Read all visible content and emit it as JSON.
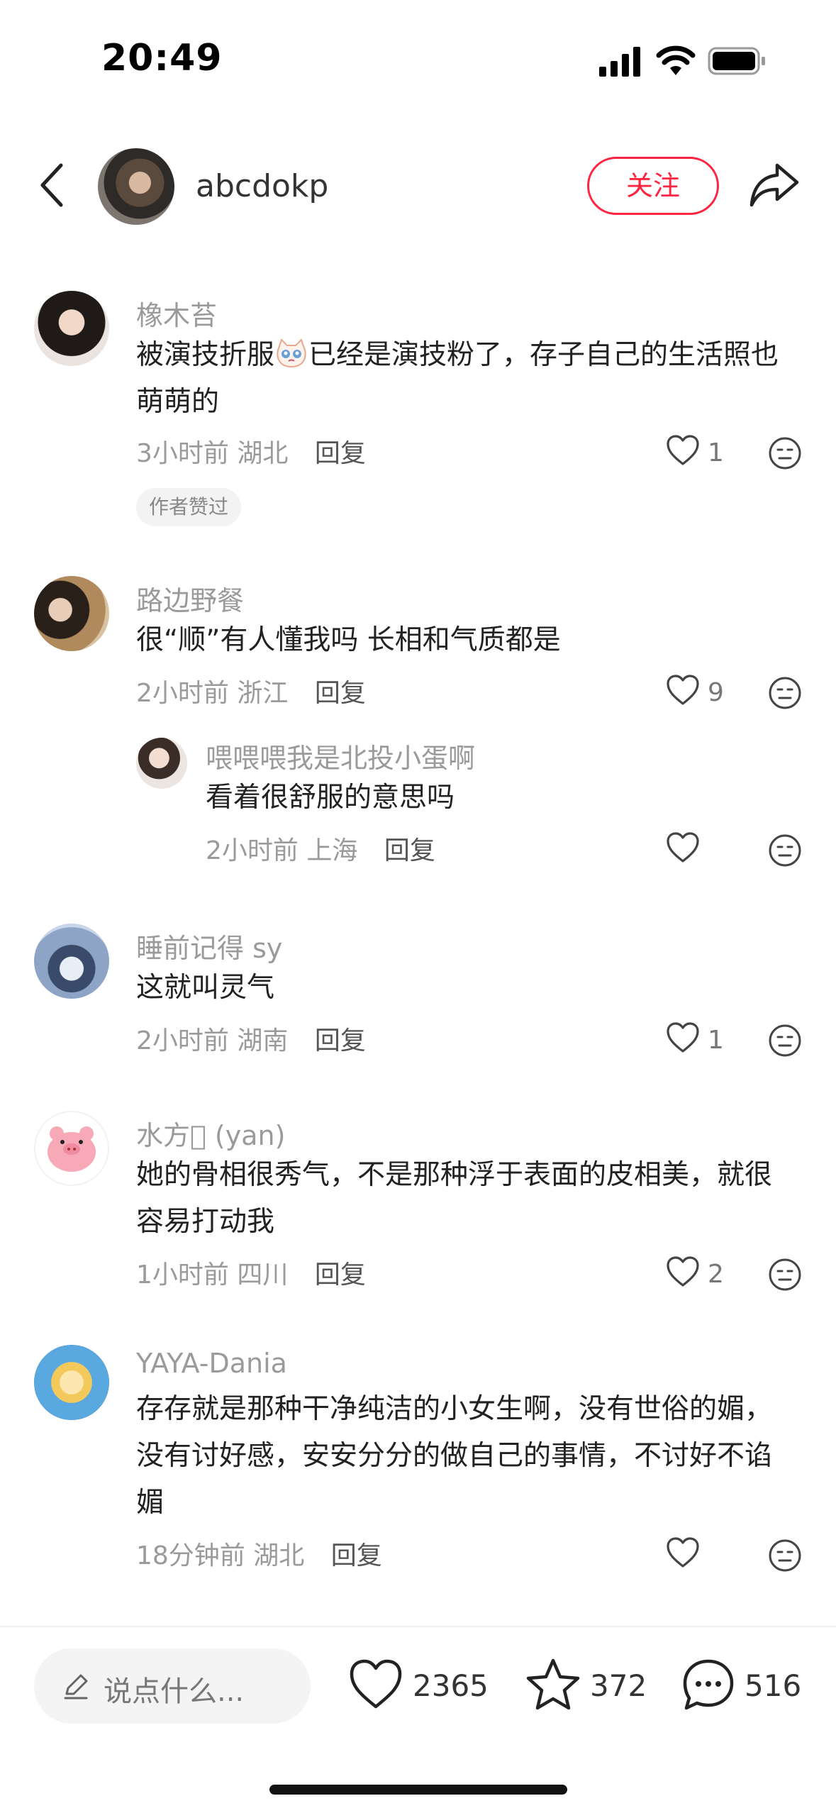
{
  "status_bar": {
    "time": "20:49"
  },
  "header": {
    "username": "abcdokp",
    "follow_label": "关注"
  },
  "comments": [
    {
      "user": "橡木苔",
      "text_before": "被演技折服",
      "text_after": "已经是演技粉了，存子自己的生活照也萌萌的",
      "time": "3小时前",
      "location": "湖北",
      "reply_label": "回复",
      "likes": "1",
      "badge": "作者赞过"
    },
    {
      "user": "路边野餐",
      "text": "很“顺”有人懂我吗 长相和气质都是",
      "time": "2小时前",
      "location": "浙江",
      "reply_label": "回复",
      "likes": "9"
    },
    {
      "user": "喂喂喂我是北投小蛋啊",
      "text": "看着很舒服的意思吗",
      "time": "2小时前",
      "location": "上海",
      "reply_label": "回复",
      "likes": ""
    },
    {
      "user": "睡前记得 sy",
      "text": "这就叫灵气",
      "time": "2小时前",
      "location": "湖南",
      "reply_label": "回复",
      "likes": "1"
    },
    {
      "user": "水方𠉀 (yan)",
      "text": "她的骨相很秀气，不是那种浮于表面的皮相美，就很容易打动我",
      "time": "1小时前",
      "location": "四川",
      "reply_label": "回复",
      "likes": "2"
    },
    {
      "user": "YAYA-Dania",
      "text": "存存就是那种干净纯洁的小女生啊，没有世俗的媚，没有讨好感，安安分分的做自己的事情，不讨好不谄媚",
      "time": "18分钟前",
      "location": "湖北",
      "reply_label": "回复",
      "likes": ""
    }
  ],
  "bottom_bar": {
    "input_placeholder": "说点什么...",
    "likes": "2365",
    "collects": "372",
    "comments": "516"
  },
  "colors": {
    "accent": "#ff2442",
    "muted": "#9a9a9a"
  }
}
